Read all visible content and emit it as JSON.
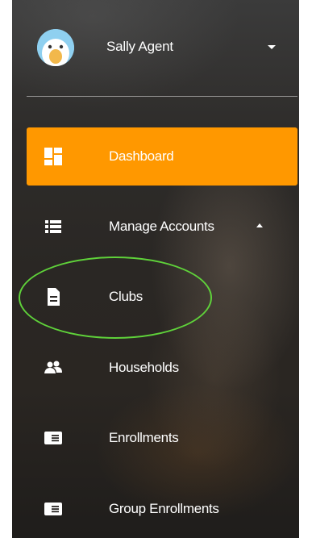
{
  "user": {
    "name": "Sally Agent",
    "avatar_icon": "duck-avatar",
    "menu_icon": "caret-down-icon"
  },
  "nav": {
    "dashboard": {
      "label": "Dashboard",
      "icon": "dashboard-icon",
      "active": true
    },
    "manage_accounts": {
      "label": "Manage Accounts",
      "icon": "list-icon",
      "expanded": true
    },
    "clubs": {
      "label": "Clubs",
      "icon": "document-icon"
    },
    "households": {
      "label": "Households",
      "icon": "people-icon"
    },
    "enrollments": {
      "label": "Enrollments",
      "icon": "enrollment-card-icon"
    },
    "group_enrollments": {
      "label": "Group Enrollments",
      "icon": "enrollment-card-icon"
    }
  },
  "colors": {
    "active_bg": "#ff9800",
    "highlight_ellipse": "#5fd23a",
    "text": "#ffffff"
  }
}
